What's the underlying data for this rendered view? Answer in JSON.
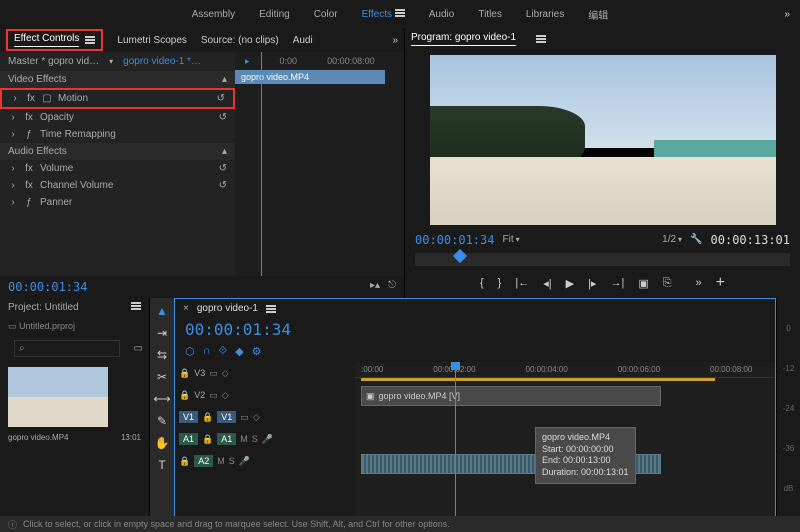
{
  "topTabs": {
    "assembly": "Assembly",
    "editing": "Editing",
    "color": "Color",
    "effects": "Effects",
    "audio": "Audio",
    "titles": "Titles",
    "libraries": "Libraries",
    "edit_cn": "编辑"
  },
  "panels": {
    "effectControls": "Effect Controls",
    "lumetri": "Lumetri Scopes",
    "source": "Source: (no clips)",
    "audioShort": "Audi",
    "program": "Program: gopro video-1"
  },
  "effects": {
    "master": "Master * gopro vid…",
    "seq": "gopro video-1 *…",
    "videoHdr": "Video Effects",
    "motion": "Motion",
    "opacity": "Opacity",
    "timeRemap": "Time Remapping",
    "audioHdr": "Audio Effects",
    "volume": "Volume",
    "channelVolume": "Channel Volume",
    "panner": "Panner",
    "ruler1": "0:00",
    "ruler2": "00:00:08:00",
    "clipName": "gopro video.MP4"
  },
  "program": {
    "tc": "00:00:01:34",
    "fit": "Fit",
    "half": "1/2",
    "dur": "00:00:13:01"
  },
  "sourceTc": "00:00:01:34",
  "project": {
    "title": "Project: Untitled",
    "file": "Untitled.prproj",
    "search": "⌕",
    "thumbName": "gopro video.MP4",
    "thumbDur": "13:01"
  },
  "timeline": {
    "seqName": "gopro video-1",
    "tc": "00:00:01:34",
    "ruler": [
      ":00:00",
      "00:00:02:00",
      "00:00:04:00",
      "00:00:06:00",
      "00:00:08:00"
    ],
    "tracks": {
      "v3": "V3",
      "v2": "V2",
      "v1": "V1",
      "a1": "A1",
      "a2": "A2"
    },
    "clipV": "gopro video.MP4 [V]",
    "tooltip": {
      "name": "gopro video.MP4",
      "start": "Start: 00:00:00:00",
      "end": "End: 00:00:13:00",
      "duration": "Duration: 00:00:13:01"
    }
  },
  "meters": [
    "0",
    "-12",
    "-24",
    "-36",
    "dB"
  ],
  "status": "Click to select, or click in empty space and drag to marquee select. Use Shift, Alt, and Ctrl for other options."
}
